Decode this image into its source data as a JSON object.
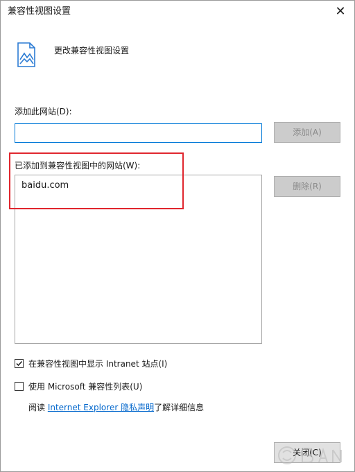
{
  "window": {
    "title": "兼容性视图设置",
    "close_glyph": "✕"
  },
  "header": {
    "text": "更改兼容性视图设置",
    "icon": "compat-view-page-icon"
  },
  "add_site": {
    "label": "添加此网站(D):",
    "input_value": "",
    "add_button": "添加(A)"
  },
  "sites": {
    "label": "已添加到兼容性视图中的网站(W):",
    "items": [
      "baidu.com"
    ],
    "remove_button": "删除(R)"
  },
  "options": {
    "intranet": {
      "label": "在兼容性视图中显示 Intranet 站点(I)",
      "checked": true
    },
    "ms_list": {
      "label": "使用 Microsoft 兼容性列表(U)",
      "checked": false
    }
  },
  "privacy": {
    "prefix": "阅读 ",
    "link": "Internet Explorer 隐私声明",
    "suffix": "了解详细信息"
  },
  "footer": {
    "close_button": "关闭(C)"
  },
  "colors": {
    "accent": "#0078d7",
    "highlight": "#e0262e",
    "link": "#0066cc"
  }
}
